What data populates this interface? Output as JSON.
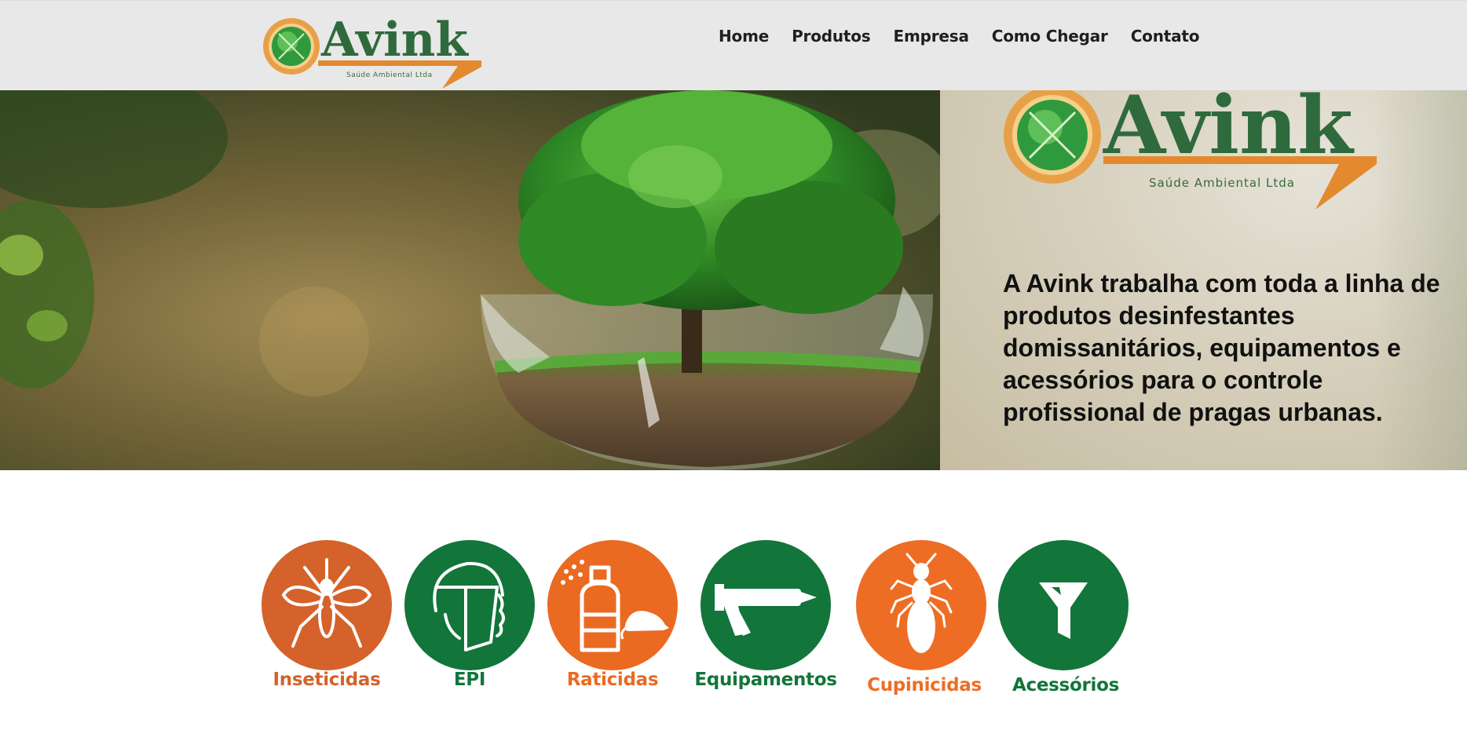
{
  "brand": {
    "name": "Avink",
    "tagline": "Saúde Ambiental Ltda",
    "green": "#3a7a3d",
    "orange": "#e38a2e"
  },
  "nav": {
    "items": [
      {
        "label": "Home"
      },
      {
        "label": "Produtos"
      },
      {
        "label": "Empresa"
      },
      {
        "label": "Como Chegar"
      },
      {
        "label": "Contato"
      }
    ]
  },
  "hero": {
    "text": "A Avink trabalha com toda a linha de produtos desinfestantes domissanitários, equipamentos e acessórios para o controle profissional de pragas urbanas."
  },
  "categories": [
    {
      "label": "Inseticidas",
      "color": "#d4622a",
      "icon": "mosquito-icon"
    },
    {
      "label": "EPI",
      "color": "#12753a",
      "icon": "face-shield-icon"
    },
    {
      "label": "Raticidas",
      "color": "#ea6a22",
      "icon": "spray-rat-icon"
    },
    {
      "label": "Equipamentos",
      "color": "#12753a",
      "icon": "caulk-gun-icon"
    },
    {
      "label": "Cupinicidas",
      "color": "#ee6d24",
      "icon": "termite-icon"
    },
    {
      "label": "Acessórios",
      "color": "#12753a",
      "icon": "funnel-icon"
    }
  ]
}
